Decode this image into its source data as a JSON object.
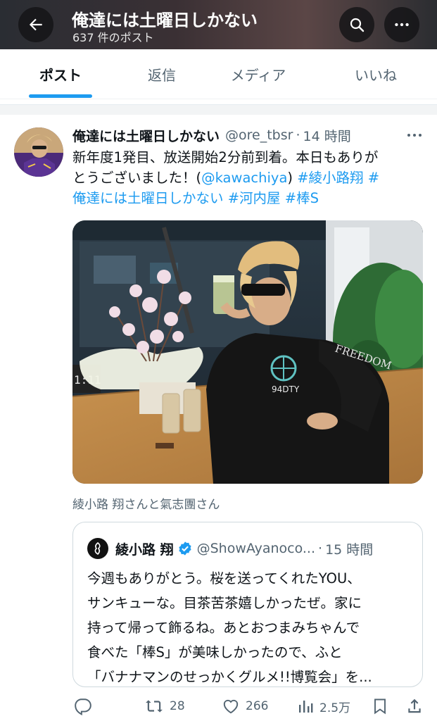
{
  "header": {
    "title": "俺達には土曜日しかない",
    "post_count": "637 件のポスト"
  },
  "tabs": [
    {
      "label": "ポスト",
      "active": true
    },
    {
      "label": "返信",
      "active": false
    },
    {
      "label": "メディア",
      "active": false
    },
    {
      "label": "いいね",
      "active": false
    }
  ],
  "tweet": {
    "author_name": "俺達には土曜日しかない",
    "handle": "@ore_tbsr",
    "separator": "·",
    "time": "14 時間",
    "text_lines": [
      [
        {
          "t": "新年度1発目、放送開始2分前到着。本日もありが",
          "link": false
        }
      ],
      [
        {
          "t": "とうございました！(",
          "link": false
        },
        {
          "t": "@kawachiya",
          "link": true
        },
        {
          "t": ") ",
          "link": false
        },
        {
          "t": "#綾小路翔 #",
          "link": true
        }
      ],
      [
        {
          "t": "俺達には土曜日しかない #河内屋 #棒S",
          "link": true
        }
      ]
    ],
    "image_caption": "綾小路 翔さんと氣志團さん"
  },
  "quote": {
    "author_name": "綾小路 翔",
    "verified": true,
    "handle": "@ShowAyanoco...",
    "time": "15 時間",
    "text_lines": [
      "今週もありがとう。桜を送ってくれたYOU、",
      "サンキューな。目茶苦茶嬉しかったぜ。家に",
      "持って帰って飾るね。あとおつまみちゃんで",
      "食べた「棒S」が美味しかったので、ふと",
      "「バナナマンのせっかくグルメ!!博覧会」を..."
    ]
  },
  "actions": {
    "reply": "",
    "retweets": "28",
    "likes": "266",
    "views": "2.5万"
  },
  "photo_text": {
    "clock": "1:11",
    "sleeve": "FREEDOM",
    "shirt": "94DTY"
  },
  "colors": {
    "accent": "#1d9bf0",
    "text": "#0f1419",
    "secondary": "#536471"
  }
}
